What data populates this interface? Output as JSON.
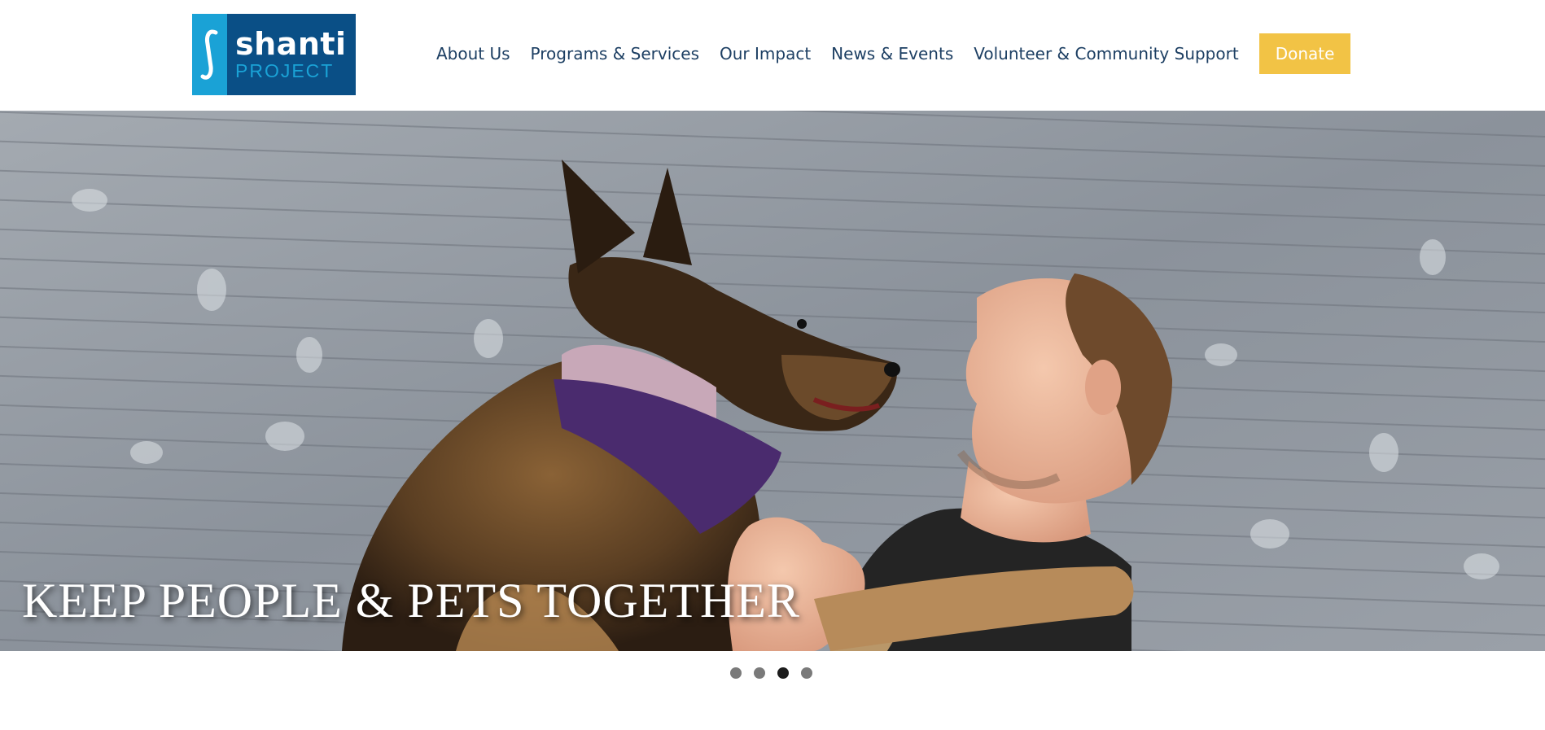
{
  "logo": {
    "word": "shanti",
    "sub": "PROJECT",
    "icon": "integral-mark-icon",
    "colors": {
      "primary": "#0a4f86",
      "secondary": "#1aa2d6"
    }
  },
  "nav": {
    "items": [
      {
        "label": "About Us"
      },
      {
        "label": "Programs & Services"
      },
      {
        "label": "Our Impact"
      },
      {
        "label": "News & Events"
      },
      {
        "label": "Volunteer & Community Support"
      }
    ],
    "donate_label": "Donate",
    "donate_color": "#f2c345",
    "text_color": "#1d3f63"
  },
  "hero": {
    "caption": "KEEP PEOPLE & PETS TOGETHER",
    "slide_count": 4,
    "active_slide": 3
  }
}
